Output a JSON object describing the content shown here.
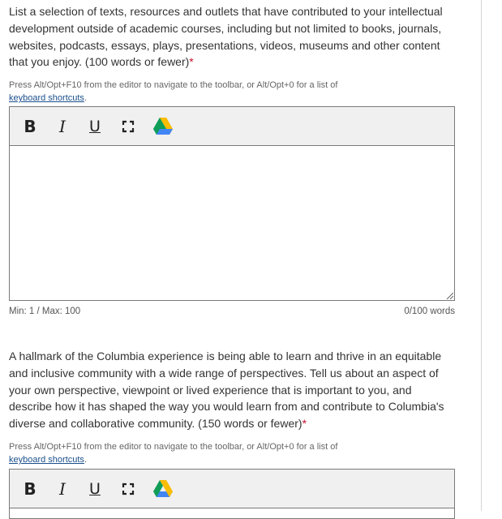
{
  "q1": {
    "prompt": "List a selection of texts, resources and outlets that have contributed to your intellectual development outside of academic courses, including but not limited to books, journals, websites, podcasts, essays, plays, presentations, videos, museums and other content that you enjoy. (100 words or fewer)",
    "required_mark": "*",
    "hint_text": "Press Alt/Opt+F10 from the editor to navigate to the toolbar, or Alt/Opt+0 for a list of",
    "hint_link": "keyboard shortcuts",
    "hint_end": ".",
    "toolbar": {
      "bold": "B",
      "italic": "I",
      "underline": "U"
    },
    "value": "",
    "limits": "Min: 1 / Max: 100",
    "word_count": "0/100 words"
  },
  "q2": {
    "prompt": "A hallmark of the Columbia experience is being able to learn and thrive in an equitable and inclusive community with a wide range of perspectives. Tell us about an aspect of your own perspective, viewpoint or lived experience that is important to you, and describe how it has shaped the way you would learn from and contribute to Columbia's diverse and collaborative community. (150 words or fewer)",
    "required_mark": "*",
    "hint_text": "Press Alt/Opt+F10 from the editor to navigate to the toolbar, or Alt/Opt+0 for a list of",
    "hint_link": "keyboard shortcuts",
    "hint_end": ".",
    "toolbar": {
      "bold": "B",
      "italic": "I",
      "underline": "U"
    }
  },
  "icons": [
    "fullscreen-icon",
    "google-drive-icon",
    "resize-handle-icon"
  ],
  "colors": {
    "required": "#c8102e",
    "link": "#1a4f8b",
    "toolbar_bg": "#f0f0f0",
    "border": "#7a7a7a"
  }
}
